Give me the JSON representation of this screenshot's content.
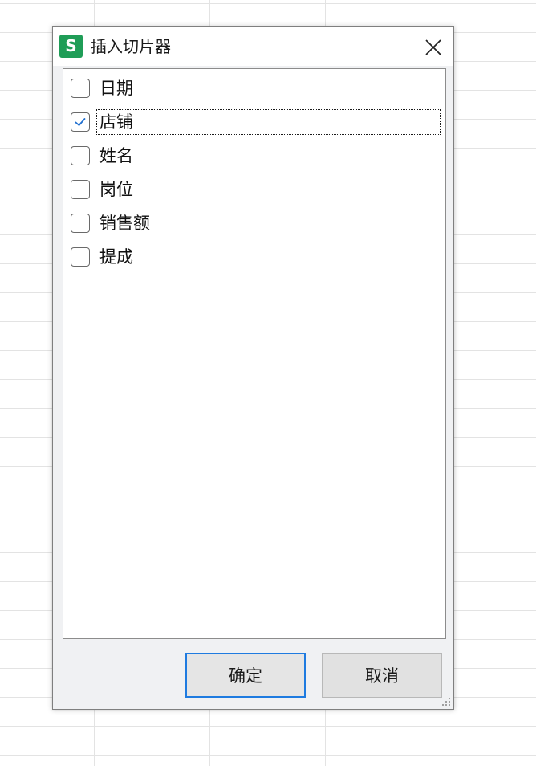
{
  "dialog": {
    "title": "插入切片器",
    "app_icon_letter": "S",
    "app_icon_color": "#1f9d57",
    "items": [
      {
        "label": "日期",
        "checked": false
      },
      {
        "label": "店铺",
        "checked": true
      },
      {
        "label": "姓名",
        "checked": false
      },
      {
        "label": "岗位",
        "checked": false
      },
      {
        "label": "销售额",
        "checked": false
      },
      {
        "label": "提成",
        "checked": false
      }
    ],
    "ok_label": "确定",
    "cancel_label": "取消",
    "accent_color": "#1f7be0"
  },
  "icons": {
    "close": "close-icon",
    "check": "checkmark-icon",
    "grip": "resize-grip-icon"
  }
}
